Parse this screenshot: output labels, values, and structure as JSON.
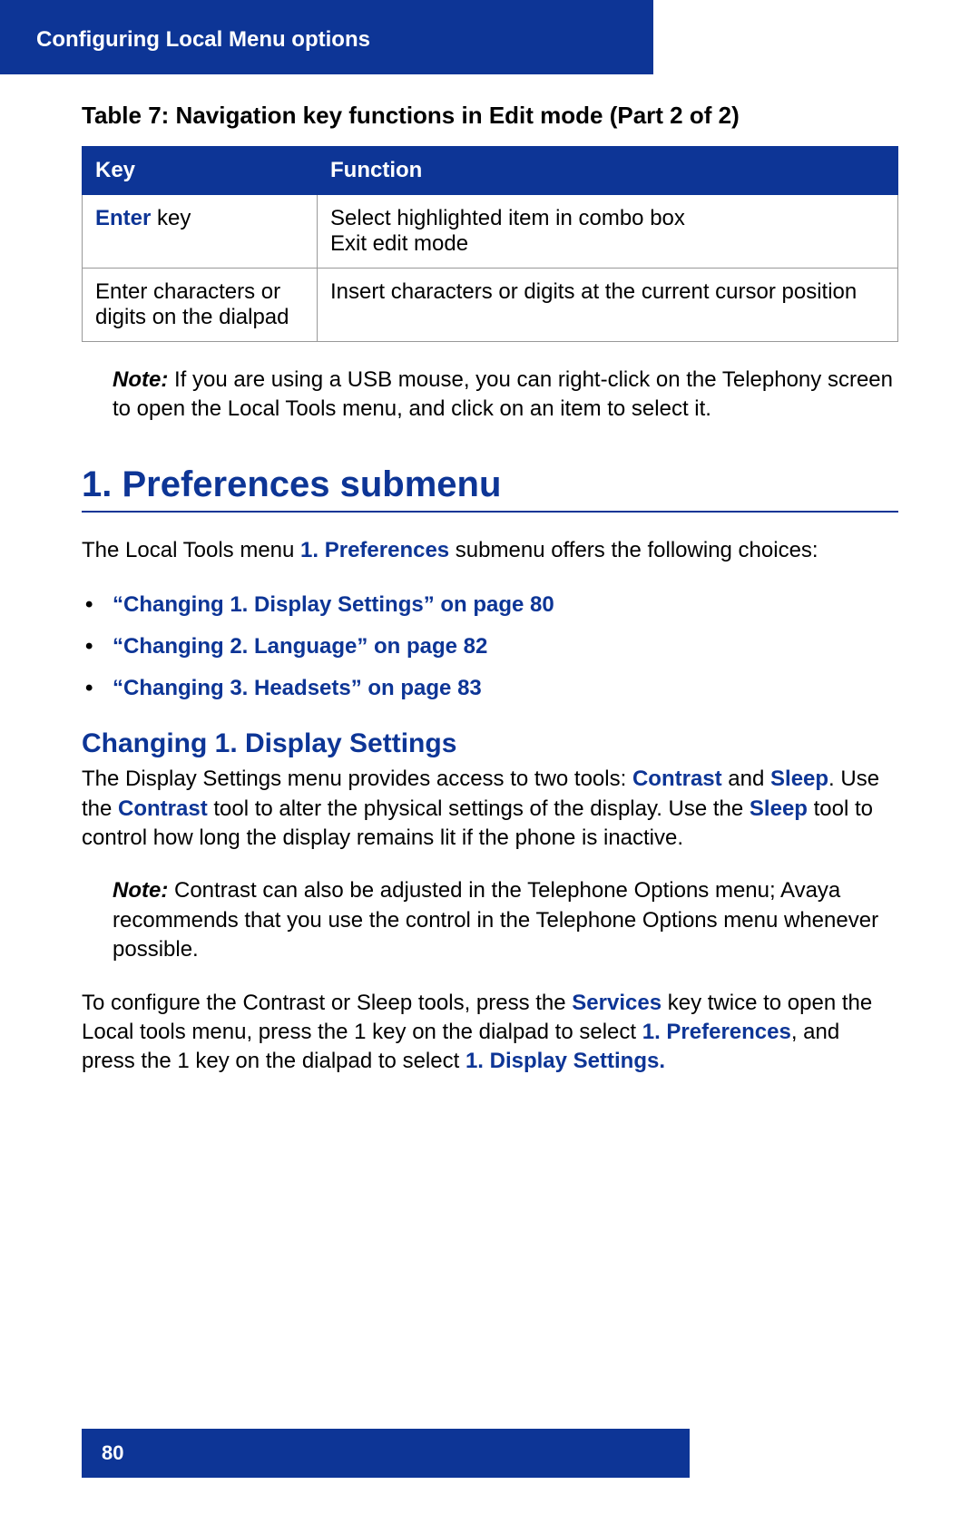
{
  "header": {
    "title": "Configuring Local Menu options"
  },
  "table": {
    "caption": "Table 7: Navigation key functions in Edit mode (Part 2 of 2)",
    "headers": {
      "key": "Key",
      "function": "Function"
    },
    "rows": [
      {
        "key_bold": "Enter",
        "key_rest": " key",
        "function": "Select highlighted item in combo box\nExit edit mode"
      },
      {
        "key_plain": "Enter characters or digits on the dialpad",
        "function": "Insert characters or digits at the current cursor position"
      }
    ]
  },
  "note1": {
    "label": "Note:",
    "text": " If you are using a USB mouse, you can right-click on the Telephony screen to open the Local Tools menu, and click on an item to select it."
  },
  "section1": {
    "heading": "1. Preferences submenu",
    "intro_pre": "The Local Tools menu ",
    "intro_bold": "1. Preferences",
    "intro_post": " submenu offers the following choices:",
    "links": [
      "“Changing 1. Display Settings” on page 80",
      "“Changing 2. Language” on page 82",
      "“Changing 3. Headsets” on page 83"
    ]
  },
  "section2": {
    "heading": "Changing 1. Display Settings",
    "p1_a": "The Display Settings menu provides access to two tools: ",
    "p1_contrast": "Contrast",
    "p1_b": " and ",
    "p1_sleep": "Sleep",
    "p1_c": ". Use the ",
    "p1_contrast2": "Contrast",
    "p1_d": " tool to alter the physical settings of the display. Use the ",
    "p1_sleep2": "Sleep",
    "p1_e": " tool to control how long the display remains lit if the phone is inactive.",
    "note": {
      "label": "Note:",
      "text": " Contrast can also be adjusted in the Telephone Options menu; Avaya recommends that you use the control in the Telephone Options menu whenever possible."
    },
    "p2_a": "To configure the Contrast or Sleep tools, press the ",
    "p2_services": "Services",
    "p2_b": " key twice to open the Local tools menu, press the 1 key on the dialpad to select ",
    "p2_pref": "1. Preferences",
    "p2_c": ", and press the 1 key on the dialpad to select ",
    "p2_disp": "1. Display Settings."
  },
  "footer": {
    "page": "80"
  }
}
